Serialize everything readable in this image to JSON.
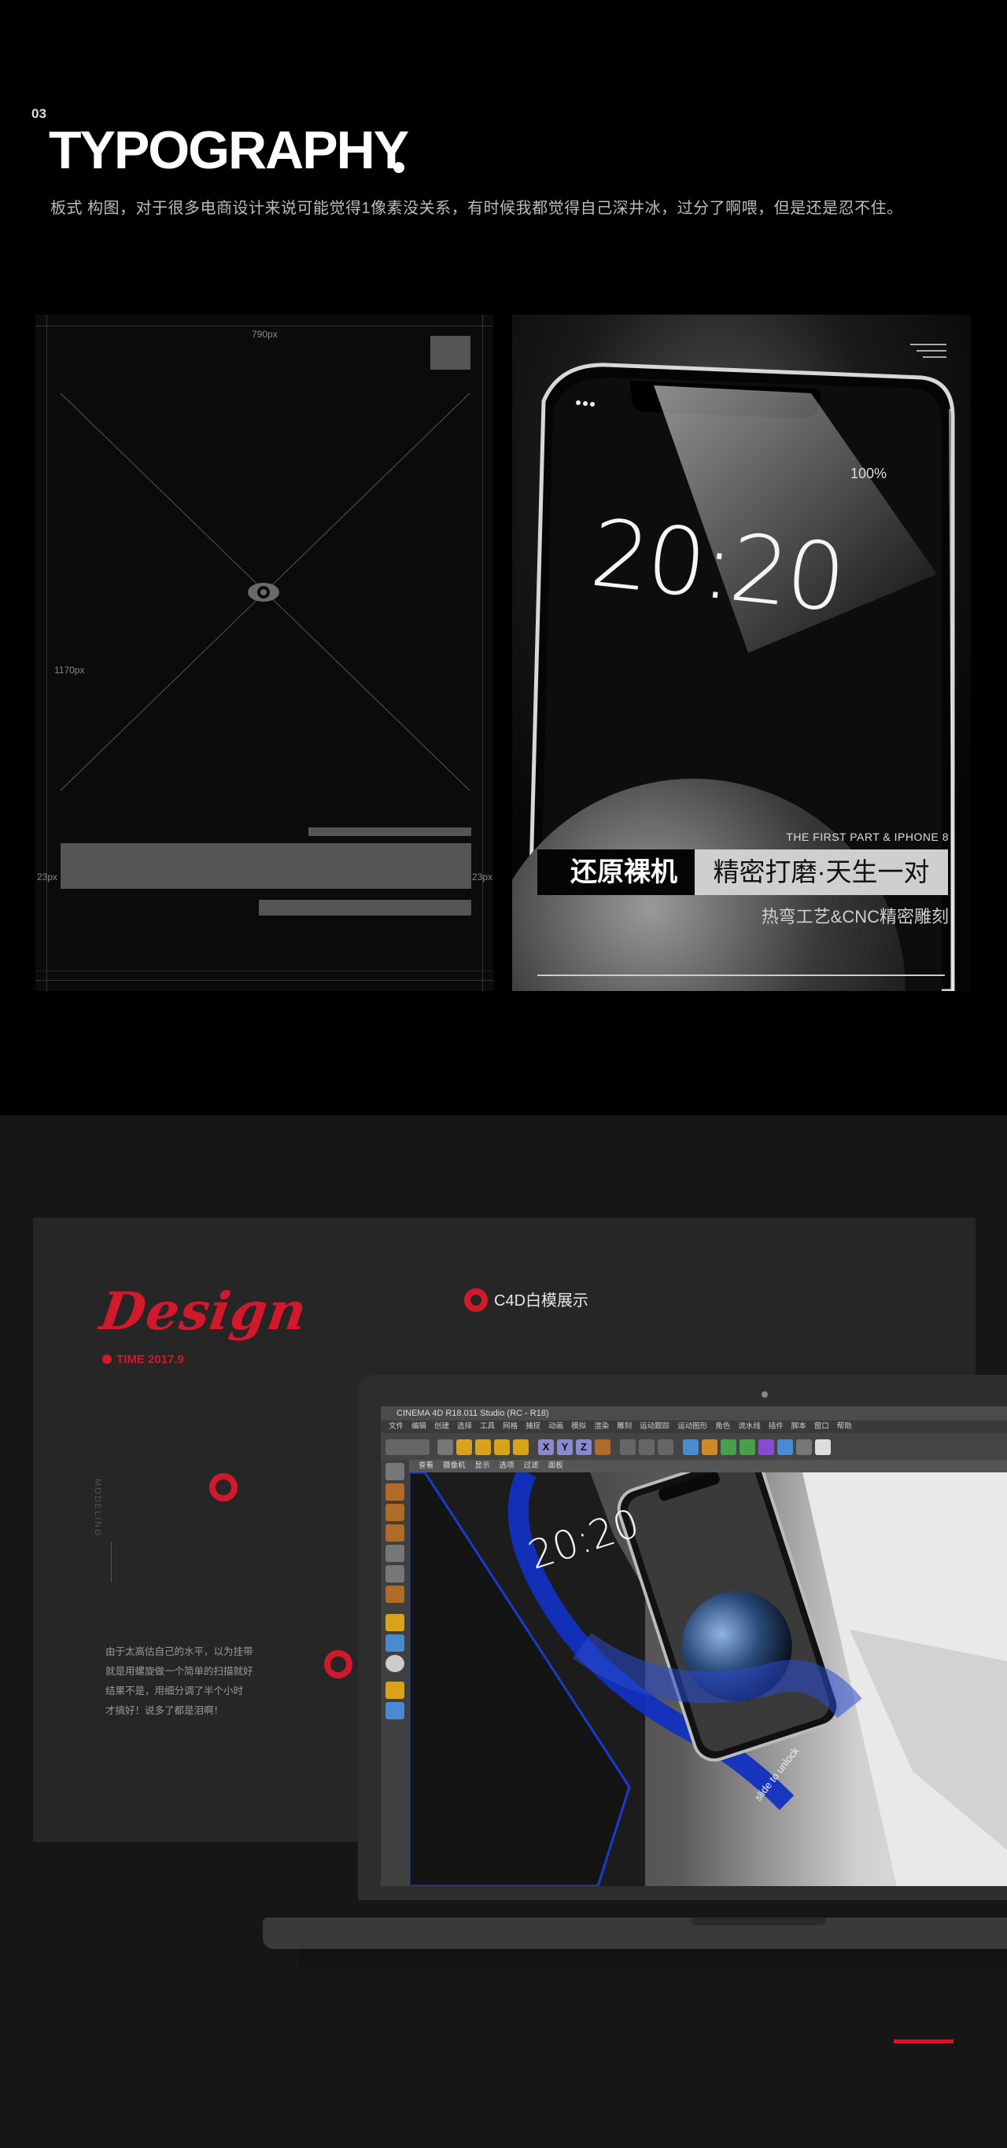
{
  "section_typography": {
    "number": "03",
    "title": "TYPOGRAPHY",
    "subtitle": "板式 构图，对于很多电商设计来说可能觉得1像素没关系，有时候我都觉得自己深井冰，过分了啊喂，但是还是忍不住。",
    "wireframe": {
      "width_label": "790px",
      "height_label": "1170px",
      "margin_left_label": "23px",
      "margin_right_label": "23px"
    },
    "poster": {
      "status_battery": "100%",
      "clock": "20:20",
      "tagline": "THE FIRST PART & IPHONE 8",
      "headline_left": "还原裸机",
      "headline_right": "精密打磨·天生一对",
      "subline": "热弯工艺&CNC精密雕刻"
    }
  },
  "section_design": {
    "design_word": "Design",
    "time_label": "TIME 2017.9",
    "c4d_label": "C4D白模展示",
    "vertical_text": "MODELING",
    "body_lines": [
      "由于太高估自己的水平，以为挂带",
      "就是用螺旋做一个简单的扫描就好",
      "结果不是，用细分调了半个小时",
      "才搞好！说多了都是泪啊！"
    ],
    "c4d_window": {
      "title": "CINEMA 4D R18.011 Studio (RC - R18)",
      "menu": [
        "文件",
        "编辑",
        "创建",
        "选择",
        "工具",
        "网格",
        "捕捉",
        "动画",
        "模拟",
        "渲染",
        "雕刻",
        "运动跟踪",
        "运动图形",
        "角色",
        "流水线",
        "插件",
        "脚本",
        "窗口",
        "帮助"
      ],
      "axis_buttons": [
        "X",
        "Y",
        "Z"
      ],
      "viewport_menu": [
        "查看",
        "摄像机",
        "显示",
        "选项",
        "过滤",
        "面板"
      ],
      "screen_clock": "20:20",
      "unlock_text": "slide to unlock"
    }
  },
  "colors": {
    "accent_red": "#d4182c",
    "section1_bg": "#000000",
    "section2_bg": "#161616",
    "card_bg": "#262626"
  }
}
